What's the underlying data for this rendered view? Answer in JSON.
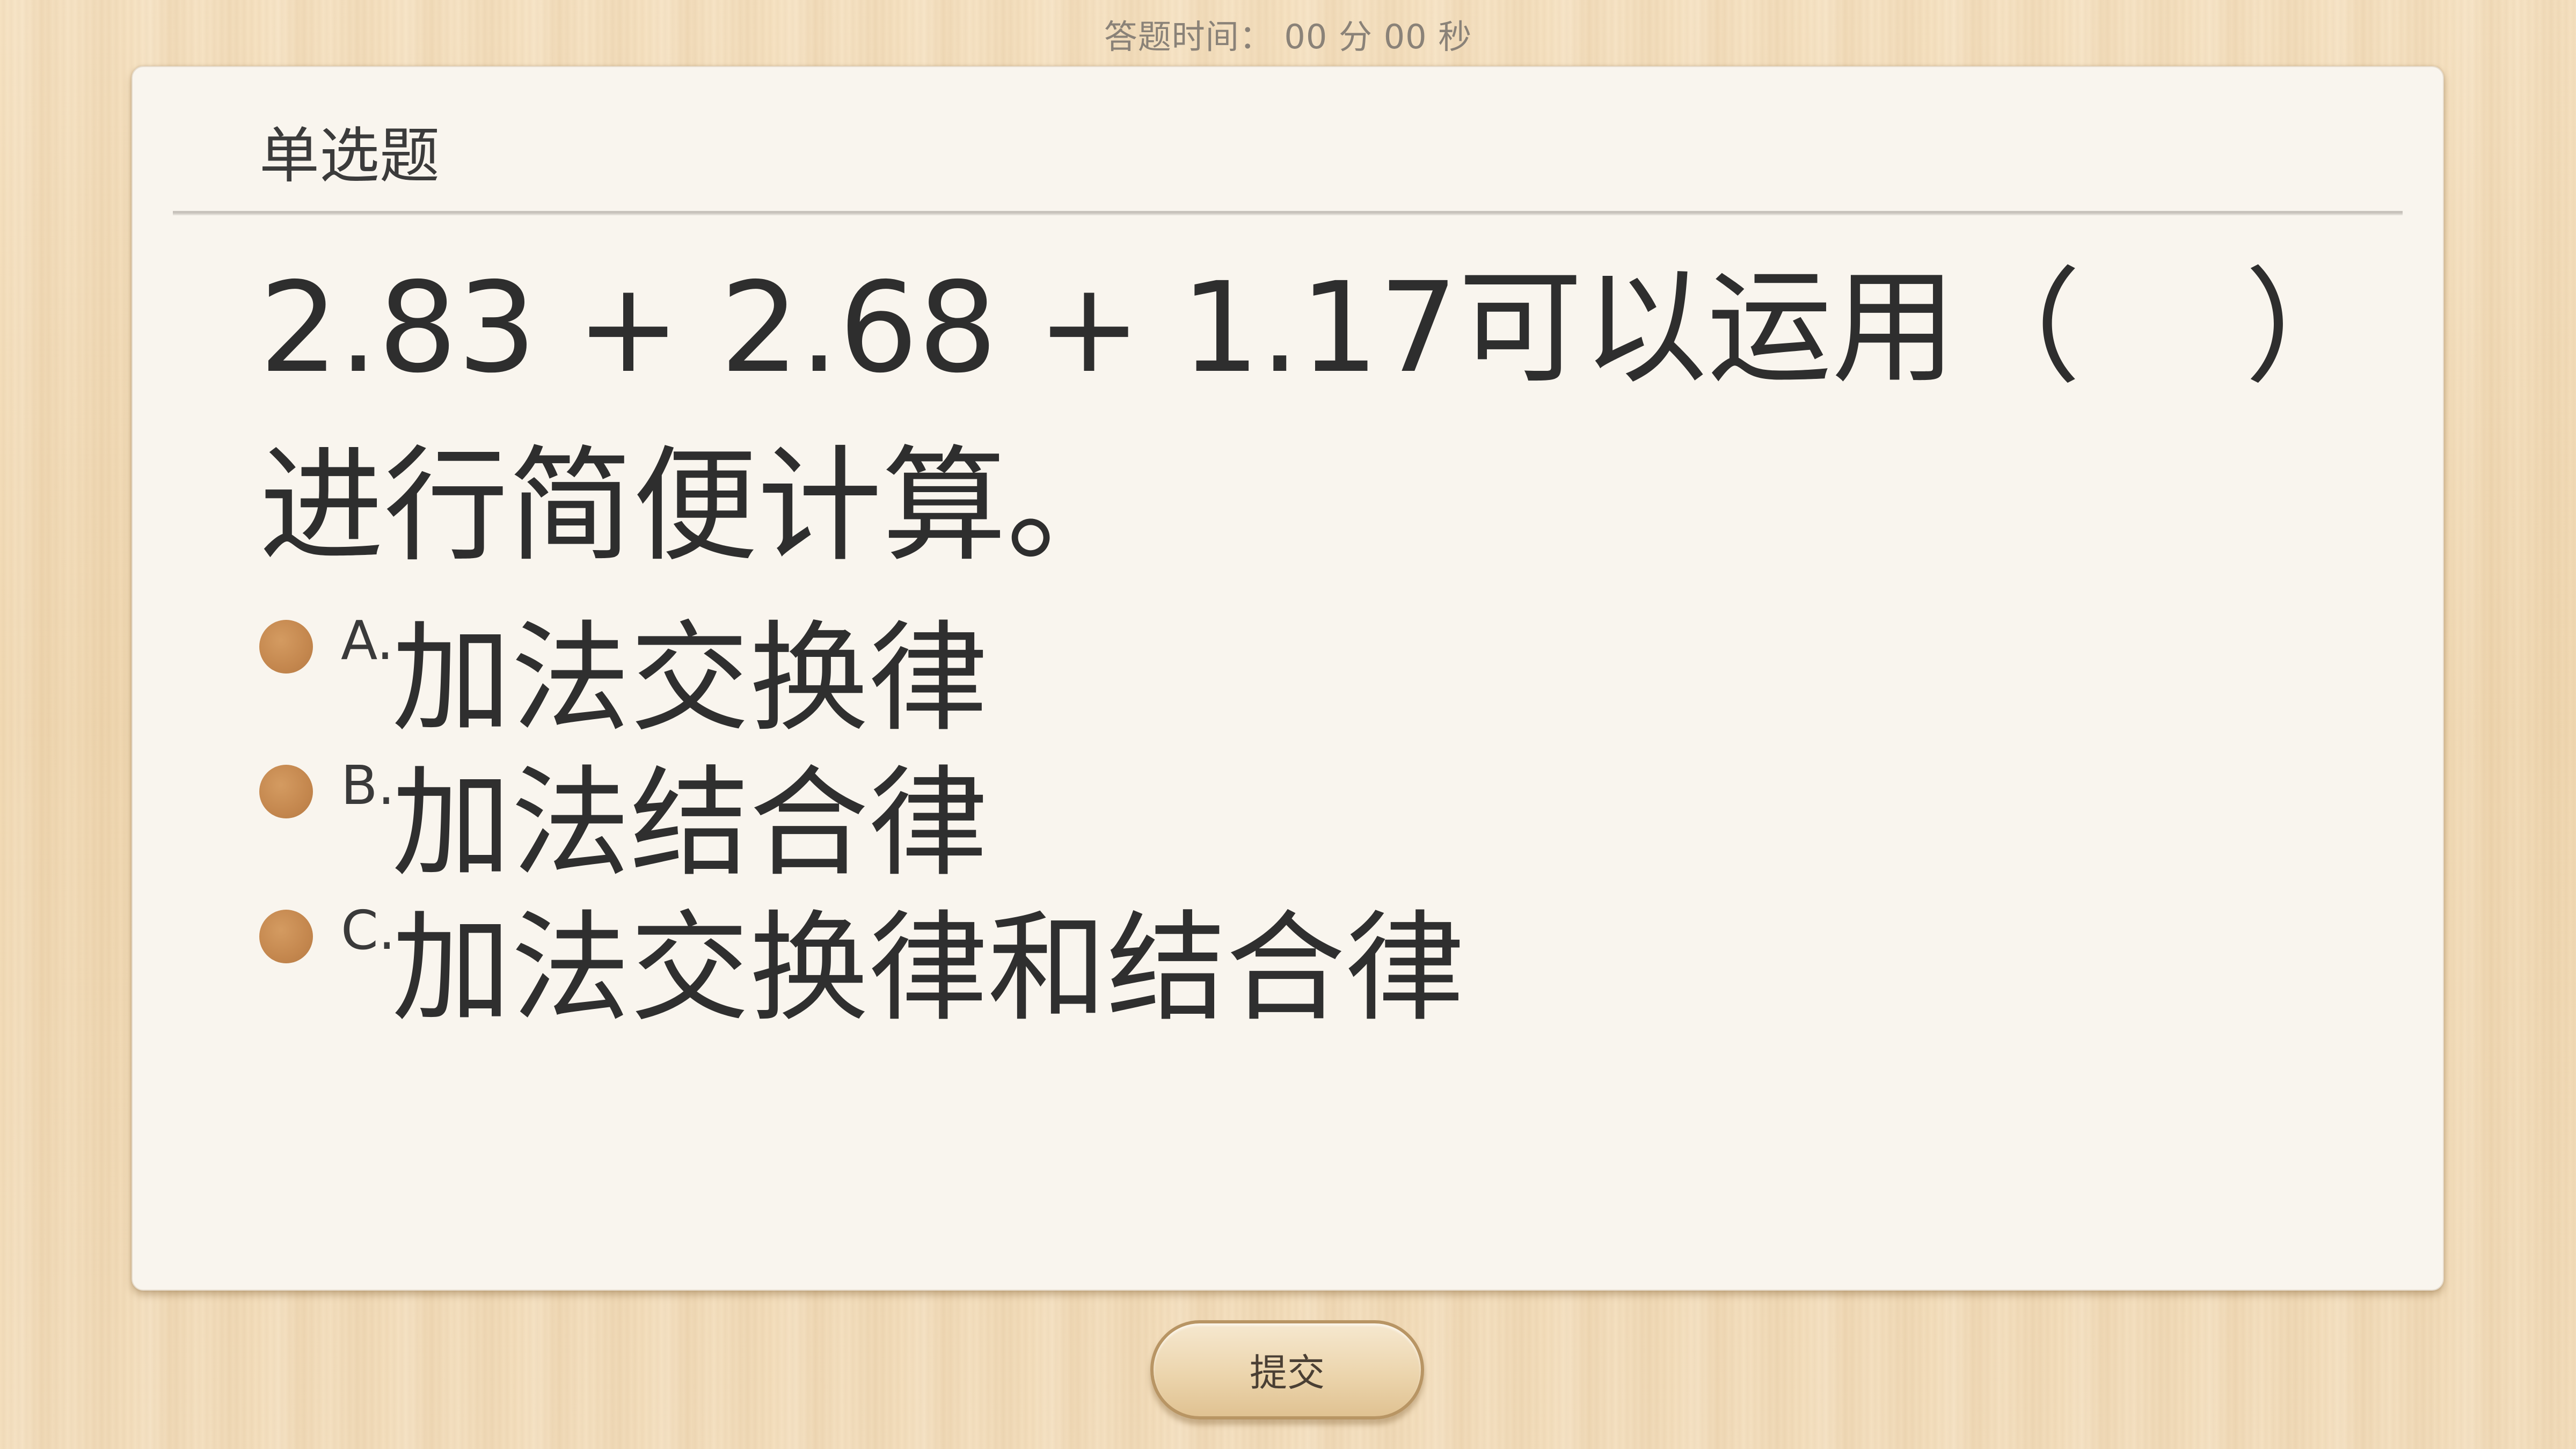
{
  "timer": {
    "text": "答题时间：  00 分 00 秒"
  },
  "card": {
    "question_type": "单选题",
    "question": "2.83 + 2.68 + 1.17可以运用（　 ）进行简便计算。",
    "options": [
      {
        "letter": "A.",
        "text": "加法交换律"
      },
      {
        "letter": "B.",
        "text": "加法结合律"
      },
      {
        "letter": "C.",
        "text": "加法交换律和结合律"
      }
    ]
  },
  "submit": {
    "label": "提交"
  },
  "colors": {
    "radio": "#c4874e",
    "card_bg": "#f9f5ee",
    "wood_bg": "#f3dcb8",
    "button_border": "#b89564"
  }
}
